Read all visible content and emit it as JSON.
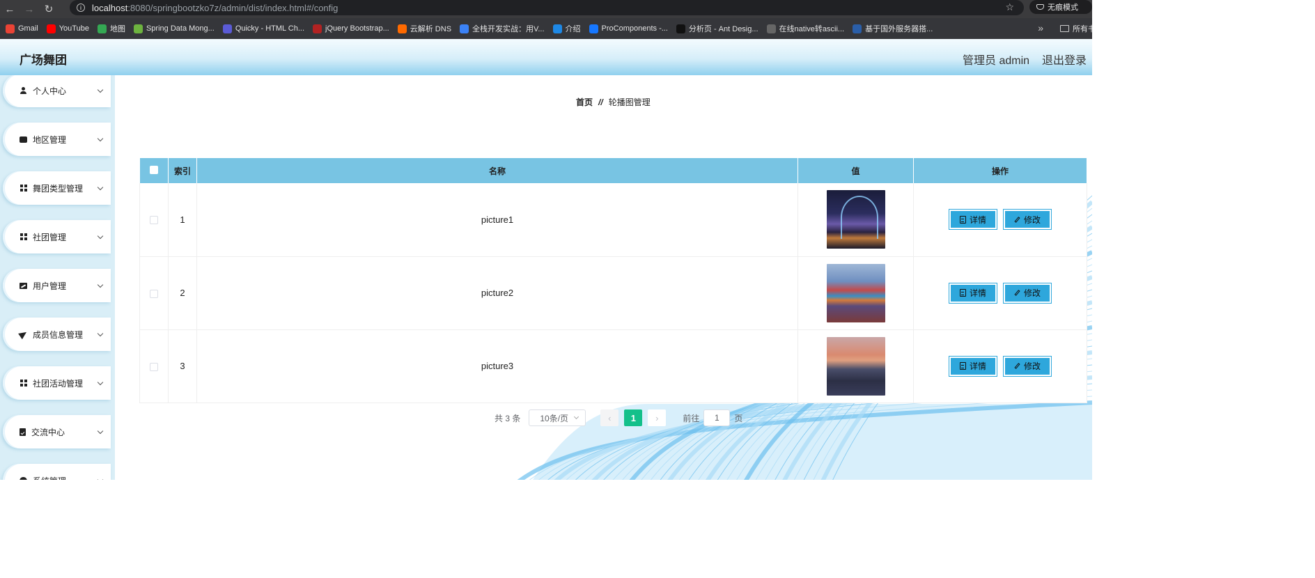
{
  "browser": {
    "url_host": "localhost",
    "url_rest": ":8080/springbootzko7z/admin/dist/index.html#/config",
    "incognito_label": "无痕模式",
    "bookmarks": [
      {
        "label": "Gmail",
        "color": "#ea4335"
      },
      {
        "label": "YouTube",
        "color": "#ff0000"
      },
      {
        "label": "地图",
        "color": "#34a853"
      },
      {
        "label": "Spring Data Mong...",
        "color": "#6db33f"
      },
      {
        "label": "Quicky - HTML Ch...",
        "color": "#5b5bd6"
      },
      {
        "label": "jQuery Bootstrap...",
        "color": "#b22222"
      },
      {
        "label": "云解析 DNS",
        "color": "#ff6a00"
      },
      {
        "label": "全栈开发实战：用V...",
        "color": "#3b82f6"
      },
      {
        "label": "介绍",
        "color": "#1e88e5"
      },
      {
        "label": "ProComponents -...",
        "color": "#1677ff"
      },
      {
        "label": "分析页 - Ant Desig...",
        "color": "#111111"
      },
      {
        "label": "在线native转ascii...",
        "color": "#666666"
      },
      {
        "label": "基于国外服务器搭...",
        "color": "#2a5ea8"
      }
    ],
    "all_bookmarks_label": "所有书"
  },
  "header": {
    "title": "广场舞团",
    "admin": "管理员 admin",
    "logout": "退出登录"
  },
  "sidebar": {
    "items": [
      {
        "label": "个人中心",
        "icon": "person-icon"
      },
      {
        "label": "地区管理",
        "icon": "chat-icon"
      },
      {
        "label": "舞团类型管理",
        "icon": "grid-icon"
      },
      {
        "label": "社团管理",
        "icon": "grid-icon"
      },
      {
        "label": "用户管理",
        "icon": "chart-icon"
      },
      {
        "label": "成员信息管理",
        "icon": "send-icon"
      },
      {
        "label": "社团活动管理",
        "icon": "grid-icon"
      },
      {
        "label": "交流中心",
        "icon": "clipboard-icon"
      },
      {
        "label": "系统管理",
        "icon": "gear-icon"
      }
    ]
  },
  "breadcrumb": {
    "home": "首页",
    "separator": "//",
    "current": "轮播图管理"
  },
  "table": {
    "headers": {
      "index": "索引",
      "name": "名称",
      "value": "值",
      "actions": "操作"
    },
    "rows": [
      {
        "index": "1",
        "name": "picture1"
      },
      {
        "index": "2",
        "name": "picture2"
      },
      {
        "index": "3",
        "name": "picture3"
      }
    ],
    "detail_label": "详情",
    "edit_label": "修改"
  },
  "pagination": {
    "total": "共 3 条",
    "page_size": "10条/页",
    "current_page": "1",
    "goto_prefix": "前往",
    "goto_value": "1",
    "goto_suffix": "页"
  },
  "colors": {
    "header_accent": "#8fd0ee",
    "table_header": "#78c4e3",
    "button": "#2ea7dc",
    "active_page": "#13c08a"
  }
}
